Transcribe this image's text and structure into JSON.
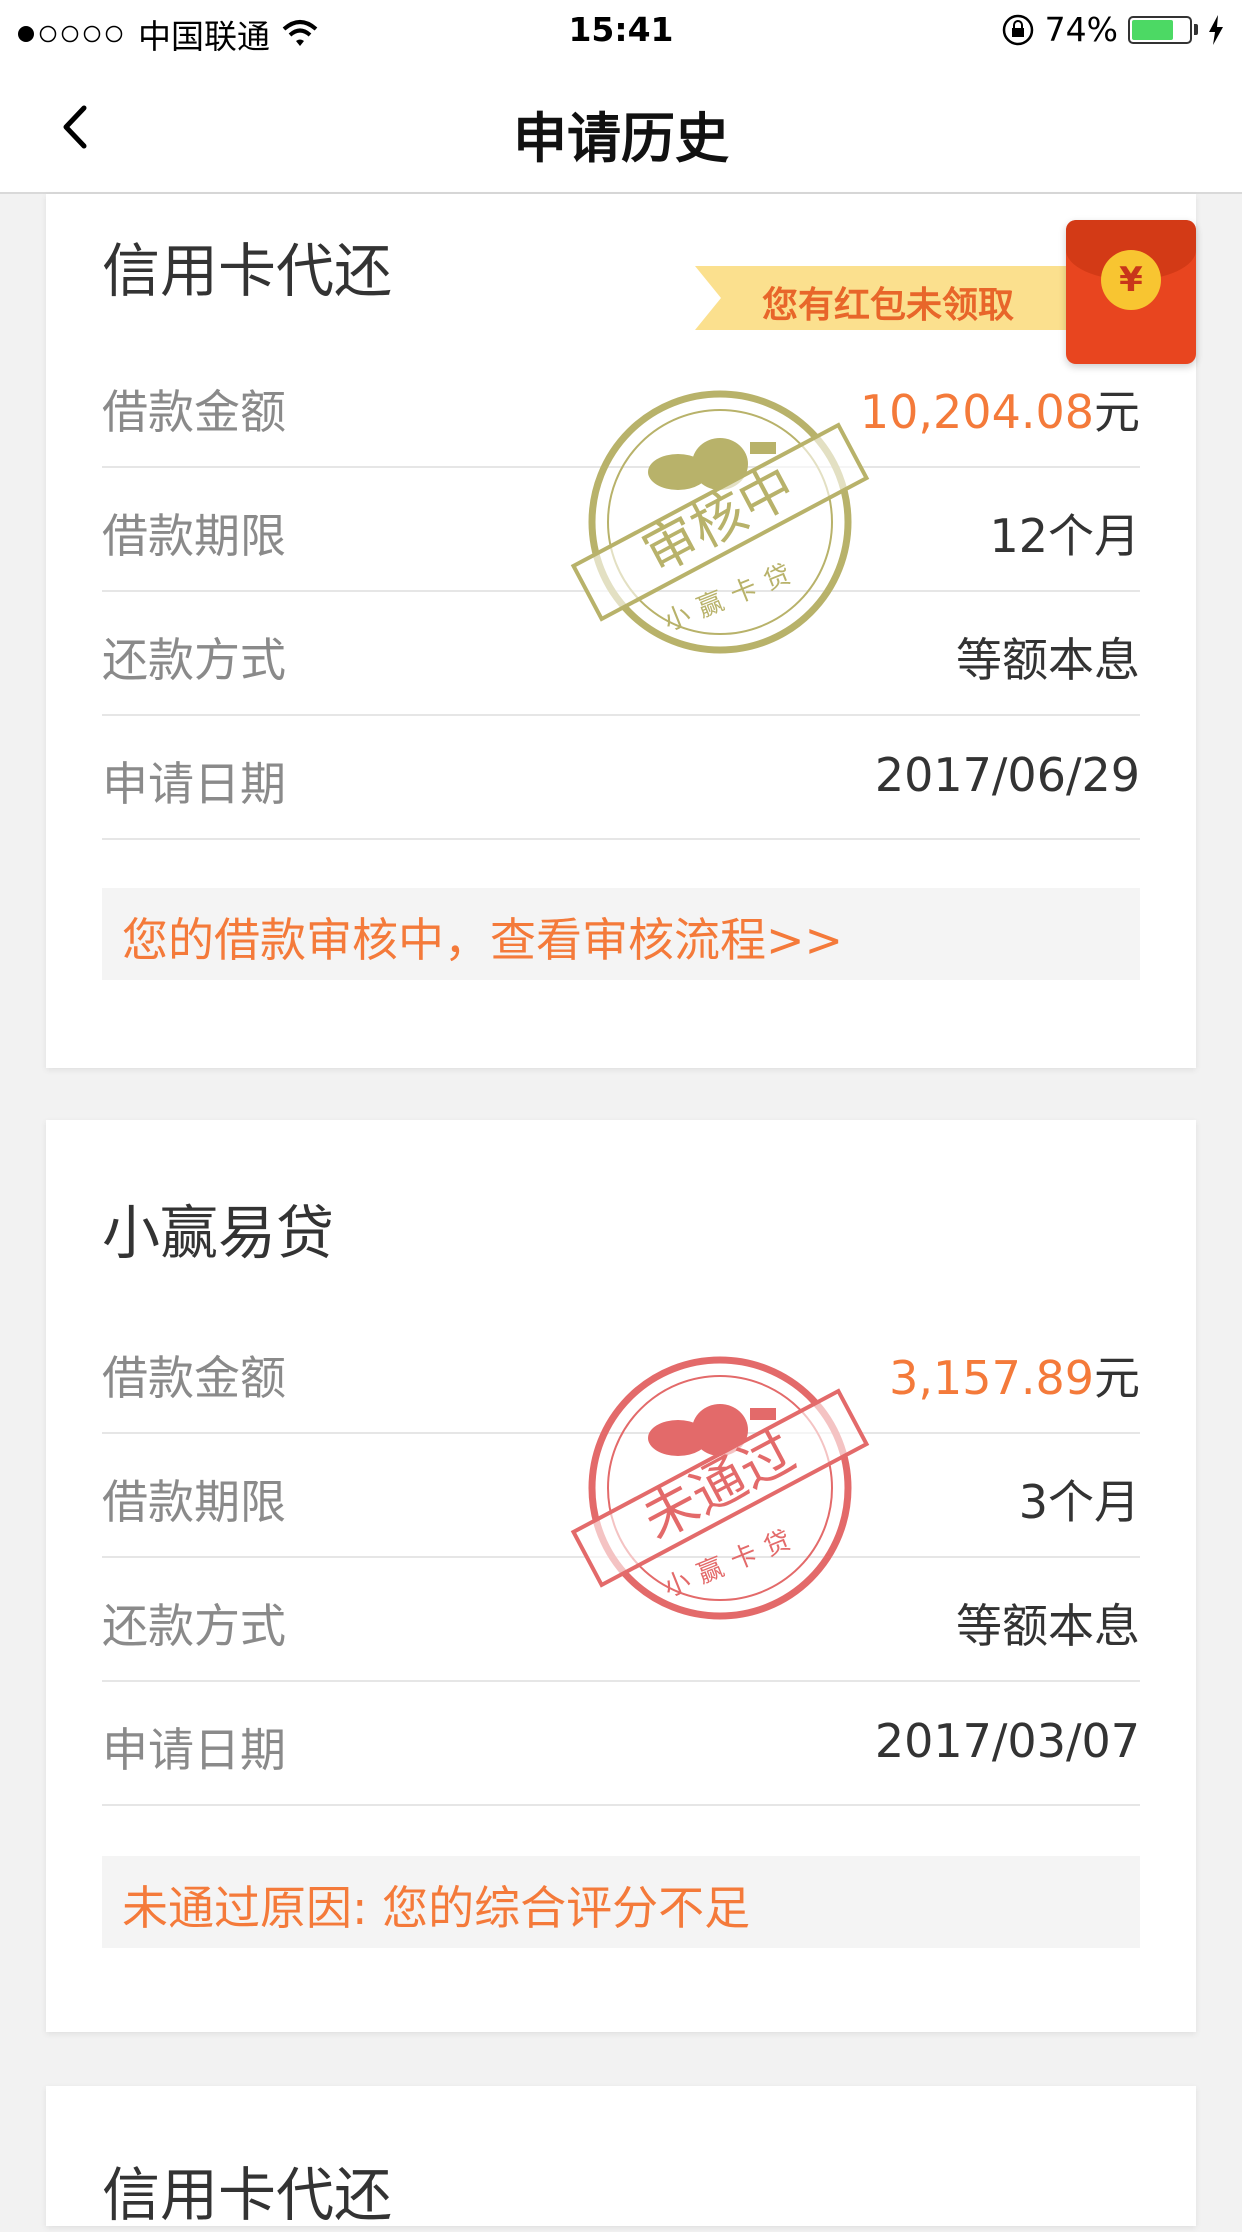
{
  "status_bar": {
    "carrier": "中国联通",
    "time": "15:41",
    "battery_percent": "74%",
    "battery_level": 0.74,
    "signal_icon": "signal-dots-icon",
    "wifi_icon": "wifi-icon",
    "lock_icon": "orientation-lock-icon",
    "charging_icon": "charging-bolt-icon"
  },
  "nav": {
    "title": "申请历史",
    "back_icon": "chevron-left-icon"
  },
  "red_packet": {
    "banner_text": "您有红包未领取",
    "coin_symbol": "¥"
  },
  "cards": [
    {
      "title": "信用卡代还",
      "stamp_text": "审核中",
      "stamp_brand": "小赢卡贷",
      "stamp_color": "#b8b26a",
      "rows": [
        {
          "label": "借款金额",
          "amount": "10,204.08",
          "unit": "元"
        },
        {
          "label": "借款期限",
          "value": "12个月"
        },
        {
          "label": "还款方式",
          "value": "等额本息"
        },
        {
          "label": "申请日期",
          "value": "2017/06/29"
        }
      ],
      "notice": "您的借款审核中，查看审核流程>>"
    },
    {
      "title": "小赢易贷",
      "stamp_text": "未通过",
      "stamp_brand": "小赢卡贷",
      "stamp_color": "#e36a6a",
      "rows": [
        {
          "label": "借款金额",
          "amount": "3,157.89",
          "unit": "元"
        },
        {
          "label": "借款期限",
          "value": "3个月"
        },
        {
          "label": "还款方式",
          "value": "等额本息"
        },
        {
          "label": "申请日期",
          "value": "2017/03/07"
        }
      ],
      "notice": "未通过原因: 您的综合评分不足"
    },
    {
      "title": "信用卡代还"
    }
  ],
  "colors": {
    "accent_orange": "#f47a3a",
    "battery_green": "#4cd964",
    "red_packet": "#e8451f"
  }
}
